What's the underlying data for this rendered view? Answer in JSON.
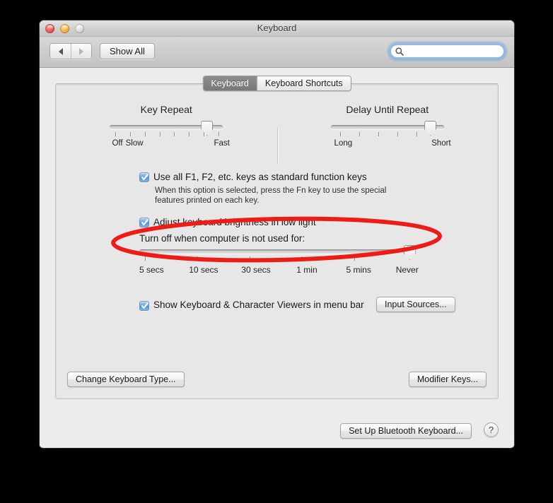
{
  "window": {
    "title": "Keyboard",
    "traffic_lights": [
      {
        "name": "close",
        "color": "#e8524a"
      },
      {
        "name": "minimize",
        "color": "#f0a93c"
      },
      {
        "name": "zoom",
        "color": "#d2d2d2"
      }
    ]
  },
  "toolbar": {
    "back_icon": "triangle-left-icon",
    "forward_icon": "triangle-right-icon",
    "show_all_label": "Show All",
    "search": {
      "icon": "search-icon",
      "value": "",
      "placeholder": ""
    }
  },
  "tabs": [
    {
      "label": "Keyboard",
      "selected": true
    },
    {
      "label": "Keyboard Shortcuts",
      "selected": false
    }
  ],
  "sliders": {
    "key_repeat": {
      "title": "Key Repeat",
      "value_percent": 86,
      "tick_percents": [
        5,
        18,
        31,
        44,
        57,
        70,
        83,
        96
      ],
      "labels": [
        {
          "text": "Off",
          "percent": 2
        },
        {
          "text": "Slow",
          "percent": 14
        },
        {
          "text": "Fast",
          "percent": 92
        }
      ]
    },
    "delay_until_repeat": {
      "title": "Delay Until Repeat",
      "value_percent": 88,
      "tick_percents": [
        8,
        25,
        42,
        59,
        76
      ],
      "labels": [
        {
          "text": "Long",
          "percent": 3
        },
        {
          "text": "Short",
          "percent": 89
        }
      ]
    },
    "idle_off": {
      "value_percent": 98,
      "tick_percents": [
        2,
        21,
        40,
        59,
        78
      ],
      "labels": [
        {
          "text": "5 secs",
          "percent": 0
        },
        {
          "text": "10 secs",
          "percent": 18
        },
        {
          "text": "30 secs",
          "percent": 37
        },
        {
          "text": "1 min",
          "percent": 57
        },
        {
          "text": "5 mins",
          "percent": 75
        },
        {
          "text": "Never",
          "percent": 93
        }
      ]
    }
  },
  "options": {
    "fn_keys": {
      "label": "Use all F1, F2, etc. keys as standard function keys",
      "checked": true,
      "description_line1": "When this option is selected, press the Fn key to use the special",
      "description_line2": "features printed on each key."
    },
    "brightness": {
      "label": "Adjust keyboard brightness in low light",
      "checked": true
    },
    "idle_title": "Turn off when computer is not used for:",
    "viewers": {
      "label": "Show Keyboard & Character Viewers in menu bar",
      "checked": true
    }
  },
  "buttons": {
    "input_sources": "Input Sources...",
    "change_keyboard_type": "Change Keyboard Type...",
    "modifier_keys": "Modifier Keys...",
    "set_up_bluetooth": "Set Up Bluetooth Keyboard...",
    "help": "?"
  },
  "annotation": {
    "shape": "ellipse",
    "color": "#ee1c16",
    "stroke_width": 6,
    "targets": "fn-keys-checkbox-row"
  }
}
